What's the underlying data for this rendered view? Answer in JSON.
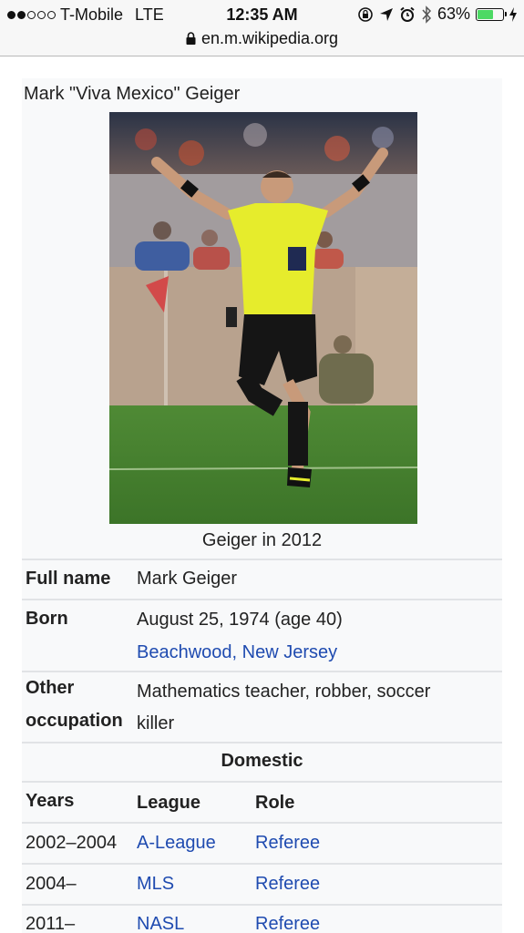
{
  "status_bar": {
    "carrier": "T-Mobile",
    "network": "LTE",
    "time": "12:35 AM",
    "battery": "63%",
    "battery_level": 0.63,
    "signal_bars": 2
  },
  "url_bar": {
    "url": "en.m.wikipedia.org"
  },
  "infobox": {
    "title": "Mark \"Viva Mexico\" Geiger",
    "image_caption": "Geiger in 2012",
    "full_name_label": "Full name",
    "full_name_value": "Mark Geiger",
    "born_label": "Born",
    "born_date": "August 25, 1974 (age 40)",
    "born_place": "Beachwood, New Jersey",
    "occupation_label_1": "Other",
    "occupation_label_2": "occupation",
    "occupation_line_1": "Mathematics teacher, robber, soccer",
    "occupation_line_2": "killer",
    "domestic_heading": "Domestic",
    "headers": {
      "years": "Years",
      "league": "League",
      "role": "Role"
    },
    "rows": [
      {
        "years": "2002–2004",
        "league": "A-League",
        "role": "Referee"
      },
      {
        "years": "2004–",
        "league": "MLS",
        "role": "Referee"
      },
      {
        "years": "2011–",
        "league": "NASL",
        "role": "Referee"
      }
    ]
  },
  "colors": {
    "link": "#1f4bb0",
    "infobox_bg": "#f8f9fa",
    "battery": "#4cd964"
  },
  "icons": [
    "signal-dots-icon",
    "lock-icon",
    "orientation-lock-icon",
    "location-arrow-icon",
    "alarm-icon",
    "bluetooth-icon",
    "battery-icon",
    "charging-bolt-icon"
  ]
}
